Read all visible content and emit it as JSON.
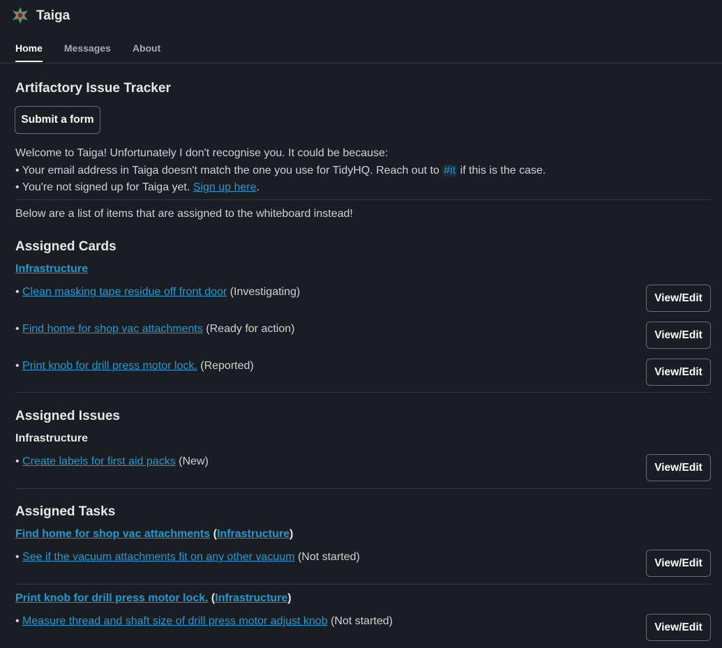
{
  "app": {
    "title": "Taiga"
  },
  "tabs": [
    {
      "label": "Home"
    },
    {
      "label": "Messages"
    },
    {
      "label": "About"
    }
  ],
  "page": {
    "title": "Artifactory Issue Tracker",
    "submit_label": "Submit a form",
    "welcome": "Welcome to Taiga! Unfortunately I don't recognise you. It could be because:",
    "reason1_pre": "• Your email address in Taiga doesn't match the one you use for TidyHQ. Reach out to ",
    "reason1_channel": "#it",
    "reason1_post": " if this is the case.",
    "reason2_pre": "• You're not signed up for Taiga yet. ",
    "reason2_link": "Sign up here",
    "reason2_post": ".",
    "whiteboard_note": "Below are a list of items that are assigned to the whiteboard instead!"
  },
  "view_edit_label": "View/Edit",
  "cards": {
    "heading": "Assigned Cards",
    "project": "Infrastructure",
    "items": [
      {
        "title": "Clean masking tape residue off front door",
        "status": "(Investigating)"
      },
      {
        "title": "Find home for shop vac attachments",
        "status": "(Ready for action)"
      },
      {
        "title": "Print knob for drill press motor lock.",
        "status": "(Reported)"
      }
    ]
  },
  "issues": {
    "heading": "Assigned Issues",
    "project": "Infrastructure",
    "items": [
      {
        "title": "Create labels for first aid packs",
        "status": "(New)"
      }
    ]
  },
  "tasks": {
    "heading": "Assigned Tasks",
    "groups": [
      {
        "parent": "Find home for shop vac attachments",
        "project": "Infrastructure",
        "items": [
          {
            "title": "See if the vacuum attachments fit on any other vacuum",
            "status": "(Not started)"
          }
        ]
      },
      {
        "parent": "Print knob for drill press motor lock.",
        "project": "Infrastructure",
        "items": [
          {
            "title": "Measure thread and shaft size of drill press motor adjust knob",
            "status": "(Not started)"
          }
        ]
      }
    ]
  },
  "punct": {
    "open": " (",
    "close": ")",
    "bullet": "• ",
    "space": " "
  },
  "icons": {
    "app": "taiga-logo-icon"
  },
  "colors": {
    "background": "#1a1d21",
    "link": "#1d9bd1",
    "text": "#d1d2d3"
  }
}
